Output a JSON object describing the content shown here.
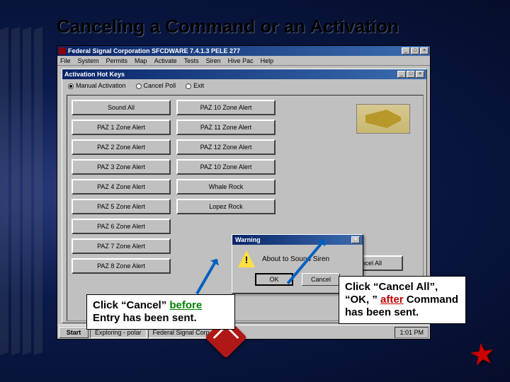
{
  "slide": {
    "title": "Canceling a Command or an Activation"
  },
  "outer_window": {
    "title": "Federal Signal Corporation SFCDWARE 7.4.1.3 PELE 277",
    "menu": [
      "File",
      "System",
      "Permits",
      "Map",
      "Activate",
      "Tests",
      "Siren",
      "Hive Pac",
      "Help"
    ]
  },
  "inner_window": {
    "title": "Activation Hot Keys",
    "radios": [
      {
        "label": "Manual Activation",
        "selected": true
      },
      {
        "label": "Cancel Poll",
        "selected": false
      },
      {
        "label": "Exit",
        "selected": false
      }
    ]
  },
  "buttons_col1": [
    "Sound All",
    "PAZ 1 Zone Alert",
    "PAZ 2 Zone Alert",
    "PAZ 3 Zone Alert",
    "PAZ 4 Zone Alert",
    "PAZ 5 Zone Alert",
    "PAZ 6 Zone Alert",
    "PAZ 7 Zone Alert",
    "PAZ 8 Zone Alert"
  ],
  "buttons_col2": [
    "PAZ 10 Zone Alert",
    "PAZ 11 Zone Alert",
    "PAZ 12 Zone Alert",
    "PAZ 10 Zone Alert",
    "Whale Rock",
    "Lopez Rock"
  ],
  "cancel_all": {
    "label": "Cancel All"
  },
  "warning": {
    "title": "Warning",
    "message": "About to Sound Siren",
    "ok": "OK",
    "cancel": "Cancel"
  },
  "taskbar": {
    "start": "Start",
    "items": [
      "Exploring - polar",
      "Federal Signal Corp..."
    ],
    "time": "1:01 PM"
  },
  "annotations": {
    "left": {
      "pre": "Click “Cancel” ",
      "hl": "before",
      "post": " Entry has been sent."
    },
    "right": {
      "pre": "Click “Cancel All”, “OK, ” ",
      "hl": "after",
      "post": " Command has been sent."
    }
  }
}
